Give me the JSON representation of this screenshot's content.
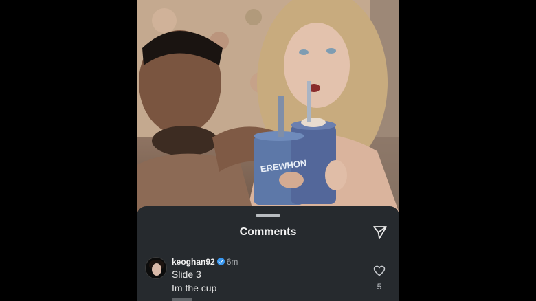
{
  "photo": {
    "alt_subject": "selfie of two people with drinks",
    "cup_text": "EREWHON"
  },
  "sheet": {
    "title": "Comments"
  },
  "comment": {
    "username": "keoghan92",
    "verified": true,
    "time": "6m",
    "lines": [
      "Slide 3",
      "Im the cup"
    ],
    "like_count": "5"
  },
  "icons": {
    "share": "paper-plane-icon",
    "like": "heart-icon",
    "verified": "verified-badge-icon"
  },
  "colors": {
    "sheet_bg": "#262a2e",
    "verified_blue": "#3897f0"
  }
}
